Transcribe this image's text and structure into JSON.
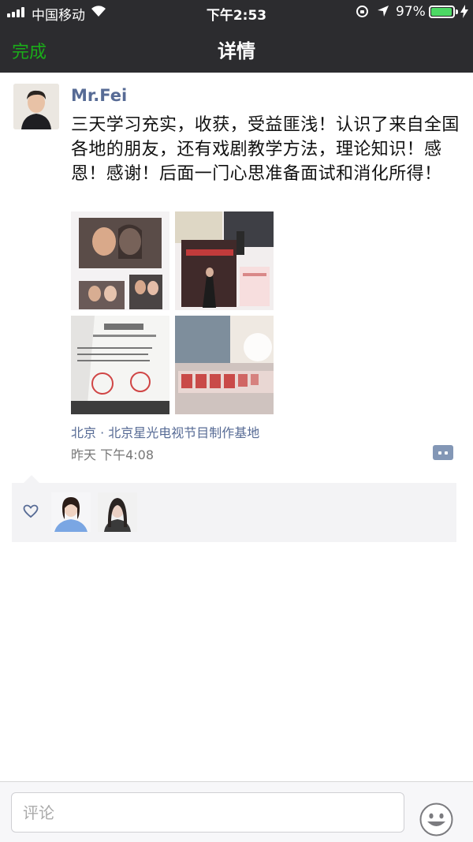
{
  "status_bar": {
    "carrier": "中国移动",
    "time": "下午2:53",
    "battery_percent": "97%",
    "battery_level": 0.97
  },
  "nav": {
    "done_label": "完成",
    "title": "详情"
  },
  "post": {
    "username": "Mr.Fei",
    "text": "三天学习充实，收获，受益匪浅！认识了来自全国各地的朋友，还有戏剧教学方法，理论知识！感恩！感谢！后面一门心思准备面试和消化所得！",
    "location": "北京 · 北京星光电视节目制作基地",
    "time": "昨天 下午4:08",
    "photos": [
      {
        "icon": "collage-photo"
      },
      {
        "icon": "event-photo"
      },
      {
        "icon": "certificate-photo"
      },
      {
        "icon": "sign-photo"
      }
    ]
  },
  "likes": {
    "icon": "heart-icon",
    "count": 2
  },
  "comment": {
    "placeholder": "评论",
    "emoji_icon": "emoji-icon"
  },
  "colors": {
    "nav_bg": "#2c2c2f",
    "accent_green": "#1aad19",
    "link_blue": "#576b95",
    "battery_green": "#4cd964"
  }
}
